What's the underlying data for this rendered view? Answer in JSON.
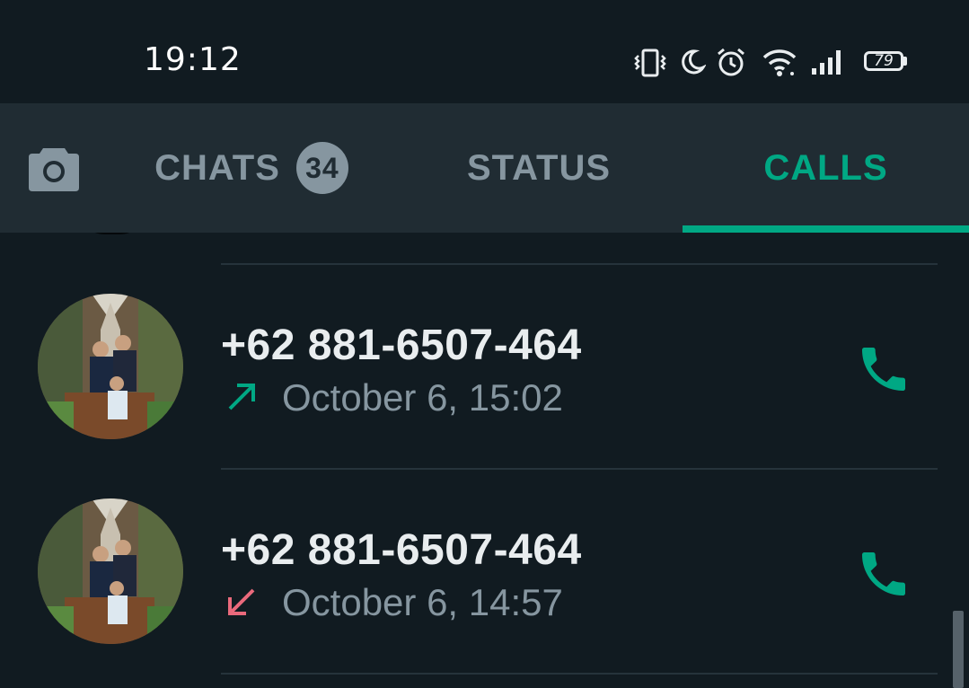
{
  "status_bar": {
    "time": "19:12",
    "battery": "79",
    "icons": [
      "vibrate-icon",
      "moon-icon",
      "alarm-icon",
      "wifi-icon",
      "signal-icon",
      "battery-icon"
    ]
  },
  "tabs": {
    "camera_icon": "camera-icon",
    "items": [
      {
        "label": "CHATS",
        "badge": "34",
        "active": false
      },
      {
        "label": "STATUS",
        "active": false
      },
      {
        "label": "CALLS",
        "active": true
      }
    ]
  },
  "calls": [
    {
      "name": "+62 881-6507-464",
      "direction": "outgoing",
      "time": "October 6, 15:02"
    },
    {
      "name": "+62 881-6507-464",
      "direction": "incoming-missed",
      "time": "October 6, 14:57"
    }
  ],
  "colors": {
    "accent": "#00a884",
    "missed": "#ea6a7c",
    "background": "#111b21",
    "tabbar": "#202c33"
  }
}
